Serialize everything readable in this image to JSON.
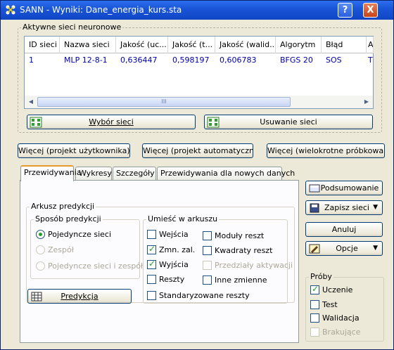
{
  "window": {
    "title": "SANN - Wyniki: Dane_energia_kurs.sta",
    "help_label": "?",
    "close_label": "X"
  },
  "networks_group": {
    "label": "Aktywne sieci neuronowe",
    "columns": [
      "ID sieci",
      "Nazwa sieci",
      "Jakość (uc...",
      "Jakość (t...",
      "Jakość (walid...",
      "Algorytm",
      "Błąd",
      "A"
    ],
    "rows": [
      [
        "1",
        "MLP 12-8-1",
        "0,636447",
        "0,598197",
        "0,606783",
        "BFGS 20",
        "SOS",
        "T"
      ]
    ],
    "scroll_grip": "III",
    "select_button": "Wybór sieci",
    "remove_button": "Usuwanie sieci"
  },
  "more_buttons": {
    "user": "Więcej (projekt użytkownika)",
    "auto": "Więcej (projekt automatyczny)",
    "resampling": "Więcej (wielokrotne próbkowanie)"
  },
  "tabs": [
    "Przewidywania",
    "Wykresy",
    "Szczegóły",
    "Przewidywania dla nowych danych"
  ],
  "predictions_tab": {
    "sheet_group_label": "Arkusz predykcji",
    "method_group_label": "Sposób predykcji",
    "methods": [
      {
        "label": "Pojedyncze sieci",
        "checked": true,
        "enabled": true
      },
      {
        "label": "Zespół",
        "checked": false,
        "enabled": false
      },
      {
        "label": "Pojedyncze sieci i zespół",
        "checked": false,
        "enabled": false
      }
    ],
    "place_group_label": "Umieść w arkuszu",
    "place_left": [
      {
        "label": "Wejścia",
        "checked": false,
        "enabled": true
      },
      {
        "label": "Zmn. zal.",
        "checked": true,
        "enabled": true
      },
      {
        "label": "Wyjścia",
        "checked": true,
        "enabled": true
      },
      {
        "label": "Reszty",
        "checked": false,
        "enabled": true
      },
      {
        "label": "Standaryzowane reszty",
        "checked": false,
        "enabled": true
      }
    ],
    "place_right": [
      {
        "label": "Moduły reszt",
        "checked": false,
        "enabled": true
      },
      {
        "label": "Kwadraty reszt",
        "checked": false,
        "enabled": true
      },
      {
        "label": "Przedziały aktywacji",
        "checked": false,
        "enabled": false
      },
      {
        "label": "Inne zmienne",
        "checked": false,
        "enabled": true
      }
    ],
    "predict_button": "Predykcja"
  },
  "side_buttons": {
    "summary": "Podsumowanie",
    "save": "Zapisz sieci",
    "cancel": "Anuluj",
    "options": "Opcje"
  },
  "samples_group": {
    "label": "Próby",
    "items": [
      {
        "label": "Uczenie",
        "checked": true,
        "enabled": true
      },
      {
        "label": "Test",
        "checked": false,
        "enabled": true
      },
      {
        "label": "Walidacja",
        "checked": false,
        "enabled": true
      },
      {
        "label": "Brakujące",
        "checked": false,
        "enabled": false
      }
    ]
  }
}
